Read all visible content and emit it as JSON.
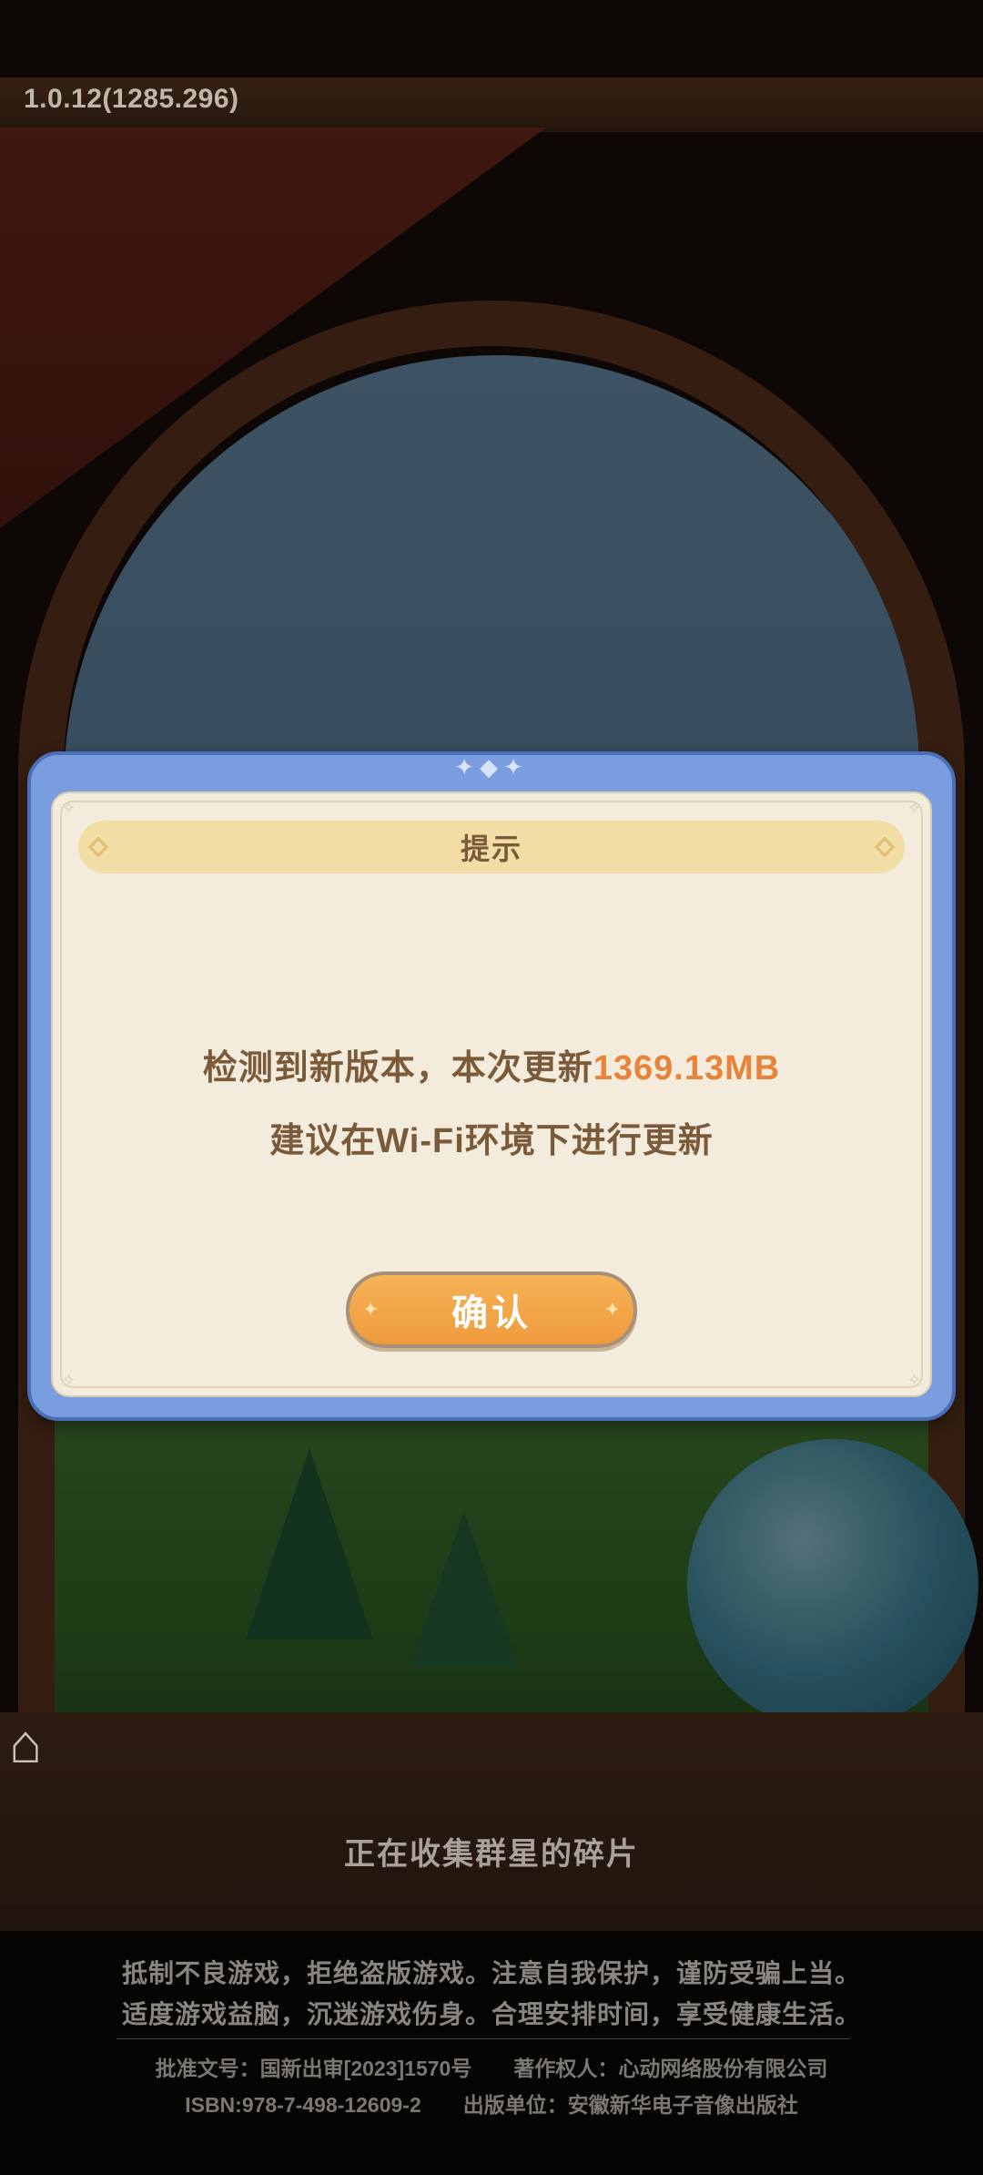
{
  "version": "1.0.12(1285.296)",
  "dialog": {
    "title": "提示",
    "message_line1_prefix": "检测到新版本，本次更新",
    "message_line1_size": "1369.13MB",
    "message_line2": "建议在Wi-Fi环境下进行更新",
    "confirm_label": "确认"
  },
  "loading_text": "正在收集群星的碎片",
  "health_notice": {
    "line1": "抵制不良游戏，拒绝盗版游戏。注意自我保护，谨防受骗上当。",
    "line2": "适度游戏益脑，沉迷游戏伤身。合理安排时间，享受健康生活。"
  },
  "legal": {
    "approval": "批准文号：国新出审[2023]1570号",
    "copyright": "著作权人：心动网络股份有限公司",
    "isbn": "ISBN:978-7-498-12609-2",
    "publisher": "出版单位：安徽新华电子音像出版社"
  },
  "colors": {
    "dialog_frame": "#7a9de0",
    "dialog_body": "#f3ecdc",
    "title_bar": "#f2dea5",
    "highlight": "#e8833a",
    "confirm_button": "#f6b257"
  }
}
